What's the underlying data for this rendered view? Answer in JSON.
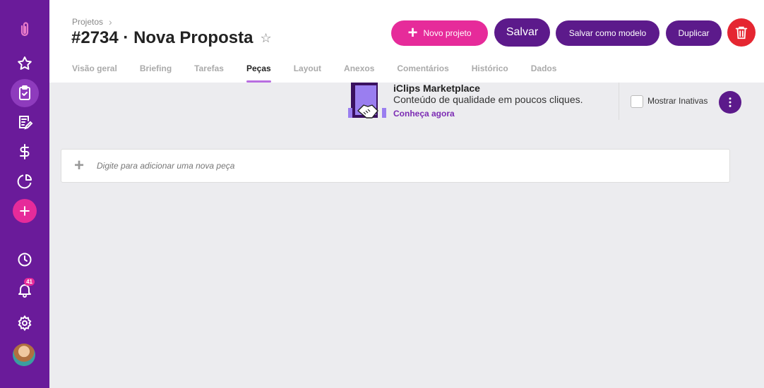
{
  "sidebar": {
    "icons": [
      "paperclip-logo-icon",
      "star-icon",
      "clipboard-check-icon",
      "document-edit-icon",
      "dollar-icon",
      "pie-chart-icon",
      "plus-icon",
      "clock-icon",
      "bell-icon",
      "gear-icon"
    ],
    "notification_count": "41",
    "brand_color": "#6a1b9a",
    "accent_color": "#e62b9a"
  },
  "header": {
    "breadcrumb": "Projetos",
    "title": "#2734 · Nova Proposta",
    "buttons": {
      "new_project": "Novo projeto",
      "save": "Salvar",
      "save_as_model": "Salvar como modelo",
      "duplicate": "Duplicar"
    },
    "tabs": [
      "Visão geral",
      "Briefing",
      "Tarefas",
      "Peças",
      "Layout",
      "Anexos",
      "Comentários",
      "Histórico",
      "Dados"
    ],
    "active_tab": "Peças"
  },
  "marketplace": {
    "title": "iClips Marketplace",
    "subtitle": "Conteúdo de qualidade em poucos cliques.",
    "link": "Conheça agora"
  },
  "filters": {
    "show_inactive_label": "Mostrar Inativas",
    "show_inactive_checked": false
  },
  "add_piece": {
    "placeholder": "Digite para adicionar uma nova peça"
  }
}
